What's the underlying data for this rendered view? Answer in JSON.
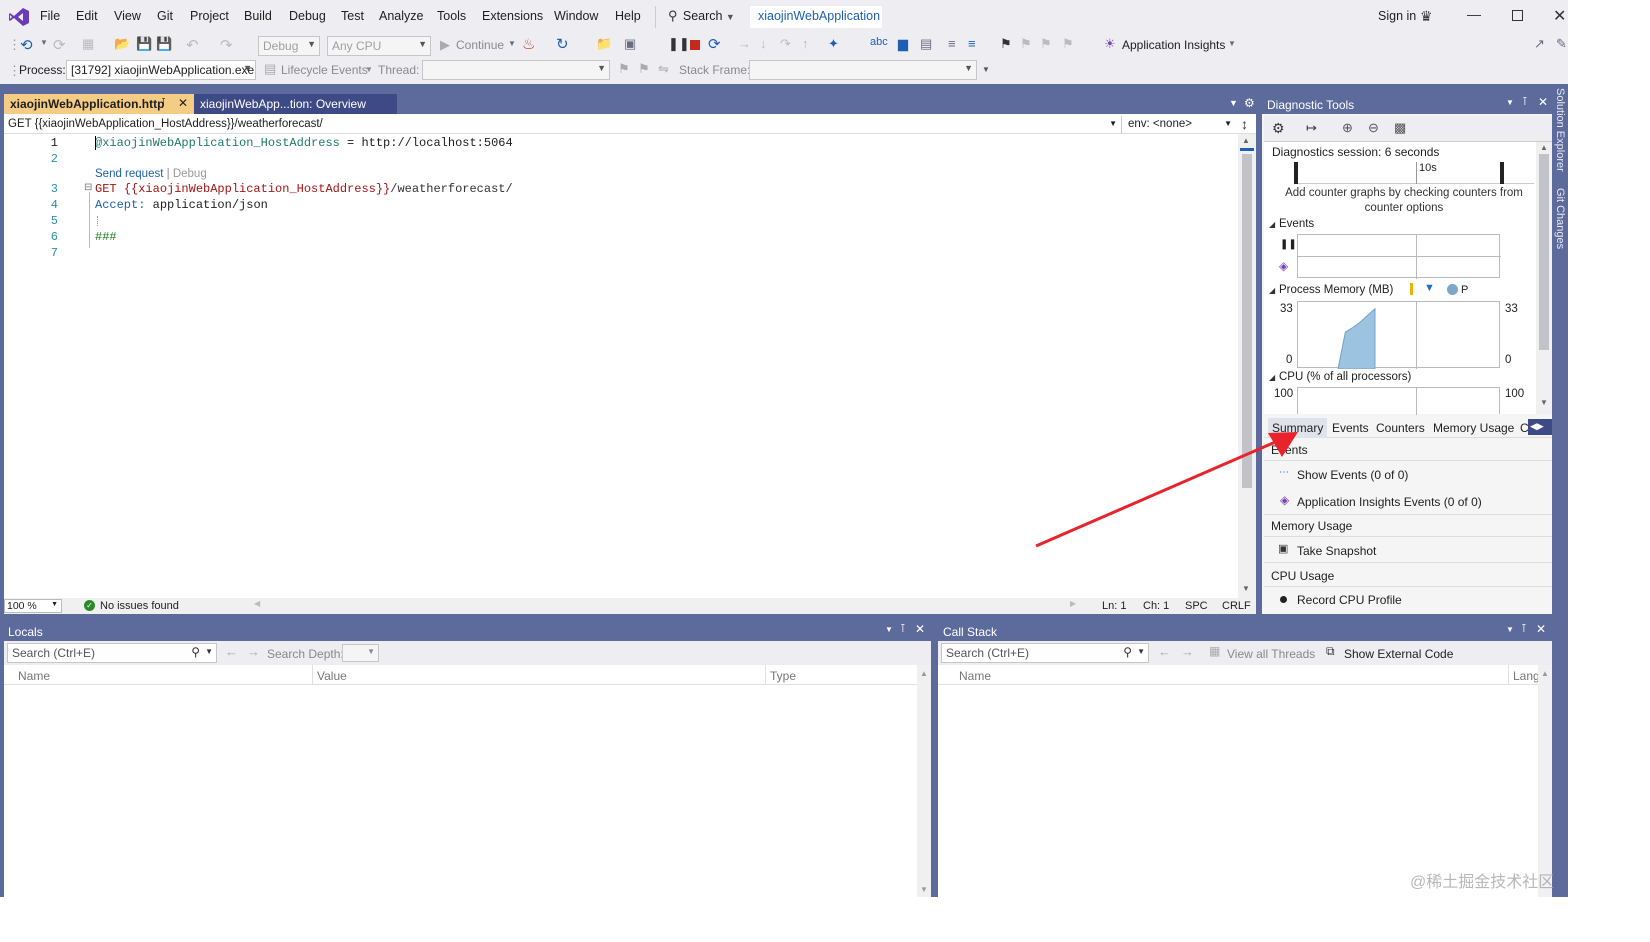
{
  "menu": {
    "items": [
      "File",
      "Edit",
      "View",
      "Git",
      "Project",
      "Build",
      "Debug",
      "Test",
      "Analyze",
      "Tools",
      "Extensions",
      "Window",
      "Help"
    ],
    "search_label": "Search",
    "solution_name": "xiaojinWebApplication",
    "sign_in": "Sign in"
  },
  "toolbar": {
    "config": "Debug",
    "platform": "Any CPU",
    "continue_label": "Continue",
    "app_insights_label": "Application Insights"
  },
  "debug_bar": {
    "process_label": "Process:",
    "process_value": "[31792] xiaojinWebApplication.exe",
    "lifecycle_label": "Lifecycle Events",
    "thread_label": "Thread:",
    "stack_frame_label": "Stack Frame:"
  },
  "editor": {
    "tabs": [
      {
        "label": "xiaojinWebApplication.http",
        "active": true
      },
      {
        "label": "xiaojinWebApp...tion: Overview",
        "active": false
      }
    ],
    "request_selector": "GET {{xiaojinWebApplication_HostAddress}}/weatherforecast/",
    "env_selector": "env: <none>",
    "line_numbers": [
      "1",
      "2",
      "",
      "3",
      "4",
      "5",
      "6",
      "7"
    ],
    "line1_var": "@xiaojinWebApplication_HostAddress",
    "line1_rest": " = http://localhost:5064",
    "codelens_send": "Send request",
    "codelens_sep": "|",
    "codelens_debug": "Debug",
    "line3_method": "GET ",
    "line3_var": "{{xiaojinWebApplication_HostAddress}}",
    "line3_path": "/weatherforecast/",
    "line4_header": "Accept:",
    "line4_value": " application/json",
    "line6_text": "###",
    "zoom": "100 %",
    "issues": "No issues found",
    "ln": "Ln: 1",
    "ch": "Ch: 1",
    "spc": "SPC",
    "crlf": "CRLF"
  },
  "diagnostics": {
    "title": "Diagnostic Tools",
    "session": "Diagnostics session: 6 seconds",
    "timeline_tick": "10s",
    "hint": "Add counter graphs by checking counters from counter options",
    "events_label": "Events",
    "memory_label": "Process Memory (MB)",
    "memory_legend_p": "P",
    "memory_max": "33",
    "memory_min": "0",
    "memory_samples_fraction": [
      0.0,
      0.55,
      0.62,
      0.7,
      0.8,
      0.9
    ],
    "cpu_label": "CPU (% of all processors)",
    "cpu_max": "100",
    "tabs": [
      "Summary",
      "Events",
      "Counters",
      "Memory Usage",
      "C"
    ],
    "summary": {
      "events_header": "Events",
      "show_events": "Show Events (0 of 0)",
      "app_insights_events": "Application Insights Events (0 of 0)",
      "memory_header": "Memory Usage",
      "take_snapshot": "Take Snapshot",
      "cpu_header": "CPU Usage",
      "record_cpu": "Record CPU Profile"
    }
  },
  "side_tabs": [
    "Solution Explorer",
    "Git Changes"
  ],
  "locals": {
    "title": "Locals",
    "search_placeholder": "Search (Ctrl+E)",
    "search_depth_label": "Search Depth:",
    "columns": [
      "Name",
      "Value",
      "Type"
    ]
  },
  "callstack": {
    "title": "Call Stack",
    "search_placeholder": "Search (Ctrl+E)",
    "view_all_threads": "View all Threads",
    "show_external": "Show External Code",
    "columns": [
      "Name",
      "Lang"
    ]
  },
  "watermark": "@稀土掘金技术社区",
  "colors": {
    "chrome": "#5c6b9c",
    "active_tab": "#f5cc84",
    "annotation_arrow": "#e8232b",
    "memory_fill": "#9cc3e0"
  }
}
